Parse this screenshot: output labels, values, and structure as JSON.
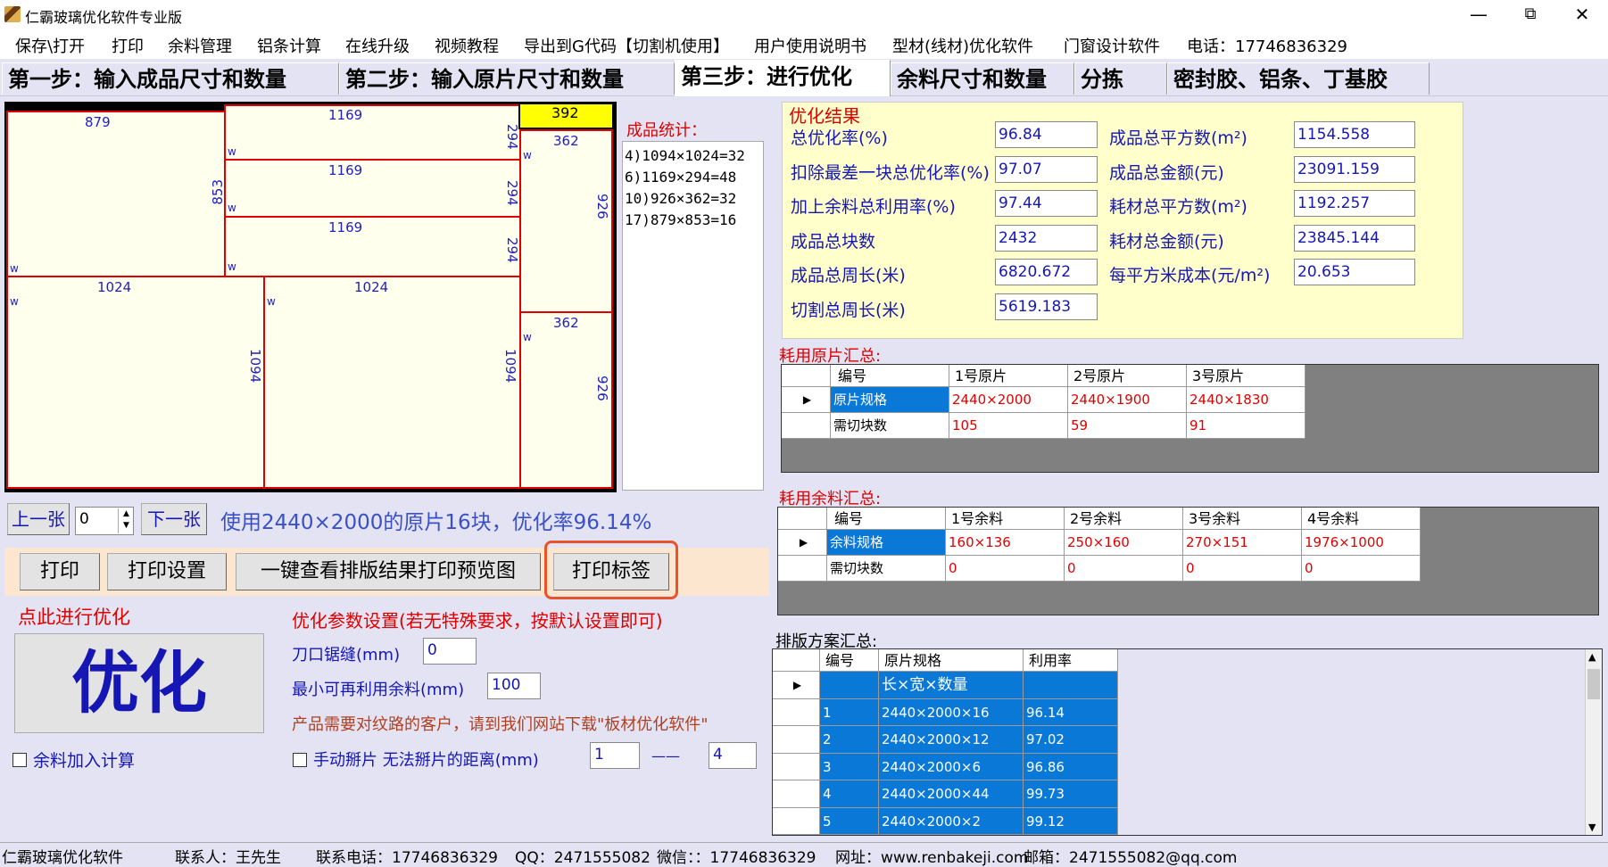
{
  "window": {
    "title": "仁霸玻璃优化软件专业版",
    "minimize": "—",
    "restore": "⧉",
    "close": "✕"
  },
  "menu": [
    "保存\\打开",
    "打印",
    "余料管理",
    "铝条计算",
    "在线升级",
    "视频教程",
    "导出到G代码【切割机使用】",
    "用户使用说明书",
    "型材(线材)优化软件",
    "门窗设计软件",
    "电话：17746836329"
  ],
  "tabs": [
    "第一步：输入成品尺寸和数量",
    "第二步：输入原片尺寸和数量",
    "第三步：进行优化",
    "余料尺寸和数量",
    "分拣",
    "密封胶、铝条、丁基胶"
  ],
  "layout_labels": {
    "p879": "879",
    "p853": "853",
    "p1169a": "1169",
    "p1169b": "1169",
    "p1169c": "1169",
    "p294a": "294",
    "p294b": "294",
    "p294c": "294",
    "p392": "392",
    "p362a": "362",
    "p926a": "926",
    "p1024a": "1024",
    "p1024b": "1024",
    "p1094a": "1094",
    "p1094b": "1094",
    "p362b": "362",
    "p926b": "926",
    "w": "w"
  },
  "stats": {
    "title": "成品统计：",
    "lines": [
      "4)1094×1024=32",
      "6)1169×294=48",
      "10)926×362=32",
      "17)879×853=16"
    ]
  },
  "nav": {
    "prev": "上一张",
    "page": "0",
    "next": "下一张",
    "summary": "使用2440×2000的原片16块，优化率96.14%"
  },
  "actions": {
    "print": "打印",
    "print_settings": "打印设置",
    "preview": "一键查看排版结果打印预览图",
    "print_label": "打印标签"
  },
  "optimize": {
    "hint": "点此进行优化",
    "button": "优化",
    "include_leftover": "余料加入计算"
  },
  "params": {
    "title": "优化参数设置(若无特殊要求，按默认设置即可)",
    "kerf_label": "刀口锯缝(mm)",
    "kerf_value": "0",
    "min_reuse_label": "最小可再利用余料(mm)",
    "min_reuse_value": "100",
    "grain_note": "产品需要对纹路的客户，请到我们网站下载\"板材优化软件\"",
    "manual_split_label": "手动掰片 无法掰片的距离(mm)",
    "split_from": "1",
    "split_dash": "——",
    "split_to": "4"
  },
  "results": {
    "title": "优化结果",
    "left": [
      {
        "label": "总优化率(%)",
        "value": "96.84"
      },
      {
        "label": "扣除最差一块总优化率(%)",
        "value": "97.07"
      },
      {
        "label": "加上余料总利用率(%)",
        "value": "97.44"
      },
      {
        "label": "成品总块数",
        "value": "2432"
      },
      {
        "label": "成品总周长(米)",
        "value": "6820.672"
      },
      {
        "label": "切割总周长(米)",
        "value": "5619.183"
      }
    ],
    "right": [
      {
        "label": "成品总平方数(m²)",
        "value": "1154.558"
      },
      {
        "label": "成品总金额(元)",
        "value": "23091.159"
      },
      {
        "label": "耗材总平方数(m²)",
        "value": "1192.257"
      },
      {
        "label": "耗材总金额(元)",
        "value": "23845.144"
      },
      {
        "label": "每平方米成本(元/m²)",
        "value": "20.653"
      }
    ]
  },
  "sheets": {
    "title": "耗用原片汇总:",
    "headers": [
      "编号",
      "1号原片",
      "2号原片",
      "3号原片"
    ],
    "rows": [
      [
        "原片规格",
        "2440×2000",
        "2440×1900",
        "2440×1830"
      ],
      [
        "需切块数",
        "105",
        "59",
        "91"
      ]
    ]
  },
  "leftovers": {
    "title": "耗用余料汇总:",
    "headers": [
      "编号",
      "1号余料",
      "2号余料",
      "3号余料",
      "4号余料"
    ],
    "rows": [
      [
        "余料规格",
        "160×136",
        "250×160",
        "270×151",
        "1976×1000"
      ],
      [
        "需切块数",
        "0",
        "0",
        "0",
        "0"
      ]
    ]
  },
  "plans": {
    "title": "排版方案汇总:",
    "headers": [
      "编号",
      "原片规格",
      "利用率"
    ],
    "rows": [
      [
        "",
        "长×宽×数量",
        ""
      ],
      [
        "1",
        "2440×2000×16",
        "96.14"
      ],
      [
        "2",
        "2440×2000×12",
        "97.02"
      ],
      [
        "3",
        "2440×2000×6",
        "96.86"
      ],
      [
        "4",
        "2440×2000×44",
        "99.73"
      ],
      [
        "5",
        "2440×2000×2",
        "99.12"
      ]
    ]
  },
  "status": [
    "仁霸玻璃优化软件",
    "联系人：王先生",
    "联系电话：17746836329",
    "QQ：2471555082",
    "微信：：17746836329",
    "网址：www.renbakeji.com",
    "邮箱：2471555082@qq.com"
  ],
  "colors": {
    "accent_blue": "#1616b4",
    "red": "#e00000",
    "grid_select": "#0a78d7",
    "result_bg": "#ffffcc"
  }
}
